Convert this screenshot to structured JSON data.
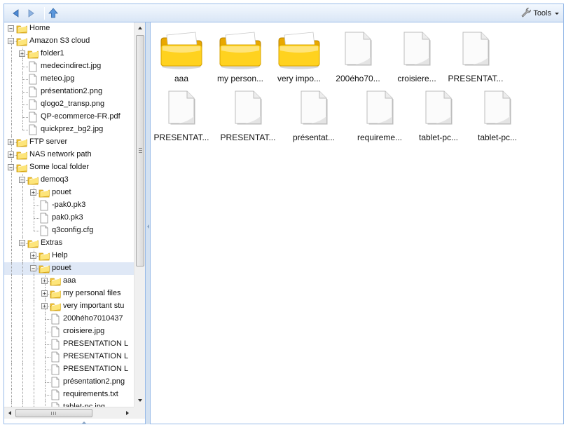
{
  "toolbar": {
    "back_icon": "arrow-left-icon",
    "forward_icon": "arrow-right-icon",
    "up_icon": "folder-up-icon",
    "tools_label": "Tools",
    "tools_icon": "wrench-icon"
  },
  "colors": {
    "panel_border": "#99bbe8",
    "selection": "#dfe8f6",
    "folder_yellow": "#f7c200",
    "toolbar_top": "#f3f8fe",
    "toolbar_bottom": "#d9e6f6"
  },
  "tree": {
    "nodes": [
      {
        "label": "Home",
        "depth": 0,
        "type": "folder",
        "toggle": "minus"
      },
      {
        "label": "Amazon S3 cloud",
        "depth": 1,
        "type": "folder",
        "toggle": "minus"
      },
      {
        "label": "folder1",
        "depth": 2,
        "type": "folder",
        "toggle": "plus"
      },
      {
        "label": "medecindirect.jpg",
        "depth": 2,
        "type": "file"
      },
      {
        "label": "meteo.jpg",
        "depth": 2,
        "type": "file"
      },
      {
        "label": "présentation2.png",
        "depth": 2,
        "type": "file"
      },
      {
        "label": "qlogo2_transp.png",
        "depth": 2,
        "type": "file"
      },
      {
        "label": "QP-ecommerce-FR.pdf",
        "depth": 2,
        "type": "file"
      },
      {
        "label": "quickprez_bg2.jpg",
        "depth": 2,
        "type": "file"
      },
      {
        "label": "FTP server",
        "depth": 1,
        "type": "folder",
        "toggle": "plus"
      },
      {
        "label": "NAS network path",
        "depth": 1,
        "type": "folder",
        "toggle": "plus"
      },
      {
        "label": "Some local folder",
        "depth": 1,
        "type": "folder",
        "toggle": "minus"
      },
      {
        "label": "demoq3",
        "depth": 2,
        "type": "folder",
        "toggle": "minus"
      },
      {
        "label": "pouet",
        "depth": 3,
        "type": "folder",
        "toggle": "plus"
      },
      {
        "label": "-pak0.pk3",
        "depth": 3,
        "type": "file"
      },
      {
        "label": "pak0.pk3",
        "depth": 3,
        "type": "file"
      },
      {
        "label": "q3config.cfg",
        "depth": 3,
        "type": "file"
      },
      {
        "label": "Extras",
        "depth": 2,
        "type": "folder",
        "toggle": "minus"
      },
      {
        "label": "Help",
        "depth": 3,
        "type": "folder",
        "toggle": "plus"
      },
      {
        "label": "pouet",
        "depth": 3,
        "type": "folder",
        "toggle": "minus",
        "selected": true
      },
      {
        "label": "aaa",
        "depth": 4,
        "type": "folder",
        "toggle": "plus"
      },
      {
        "label": "my personal files",
        "depth": 4,
        "type": "folder",
        "toggle": "plus"
      },
      {
        "label": "very important stu",
        "depth": 4,
        "type": "folder",
        "toggle": "plus"
      },
      {
        "label": "200hého7010437",
        "depth": 4,
        "type": "file"
      },
      {
        "label": "croisiere.jpg",
        "depth": 4,
        "type": "file"
      },
      {
        "label": "PRESENTATION L",
        "depth": 4,
        "type": "file"
      },
      {
        "label": "PRESENTATION L",
        "depth": 4,
        "type": "file"
      },
      {
        "label": "PRESENTATION L",
        "depth": 4,
        "type": "file"
      },
      {
        "label": "présentation2.png",
        "depth": 4,
        "type": "file"
      },
      {
        "label": "requirements.txt",
        "depth": 4,
        "type": "file"
      },
      {
        "label": "tablet-pc.jpg",
        "depth": 4,
        "type": "file"
      }
    ]
  },
  "main": {
    "items": [
      {
        "label": "aaa",
        "type": "folder"
      },
      {
        "label": "my person...",
        "type": "folder"
      },
      {
        "label": "very impo...",
        "type": "folder"
      },
      {
        "label": "200ého70...",
        "type": "file"
      },
      {
        "label": "croisiere...",
        "type": "file"
      },
      {
        "label": "PRESENTAT...",
        "type": "file"
      },
      {
        "label": "PRESENTAT...",
        "type": "file"
      },
      {
        "label": "PRESENTAT...",
        "type": "file"
      },
      {
        "label": "présentat...",
        "type": "file"
      },
      {
        "label": "requireme...",
        "type": "file"
      },
      {
        "label": "tablet-pc...",
        "type": "file"
      },
      {
        "label": "tablet-pc...",
        "type": "file"
      }
    ]
  }
}
